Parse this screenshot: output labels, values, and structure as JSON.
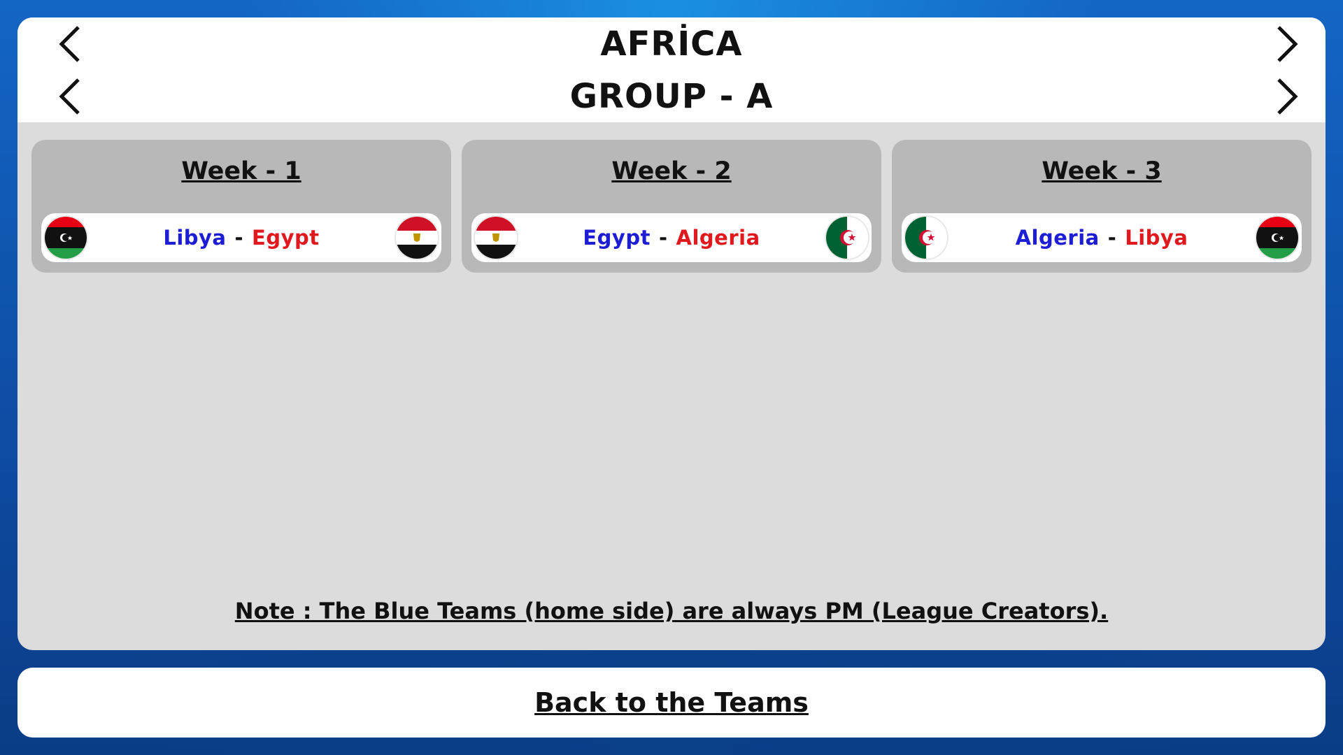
{
  "header": {
    "region": "AFRİCA",
    "group": "GROUP - A"
  },
  "weeks": [
    {
      "title": "Week - 1",
      "home": "Libya",
      "sep": "-",
      "away": "Egypt",
      "home_flag": "libya-flag",
      "away_flag": "egypt-flag"
    },
    {
      "title": "Week - 2",
      "home": "Egypt",
      "sep": "-",
      "away": "Algeria",
      "home_flag": "egypt-flag",
      "away_flag": "algeria-flag"
    },
    {
      "title": "Week - 3",
      "home": "Algeria",
      "sep": "-",
      "away": "Libya",
      "home_flag": "algeria-flag",
      "away_flag": "libya-flag"
    }
  ],
  "note": "Note : The Blue Teams (home side) are always PM (League Creators).",
  "back_button": "Back to the Teams",
  "colors": {
    "home_team": "#1d1dd6",
    "away_team": "#e0191f",
    "panel": "#dcdcdc",
    "week_card": "#b8b8b8"
  }
}
